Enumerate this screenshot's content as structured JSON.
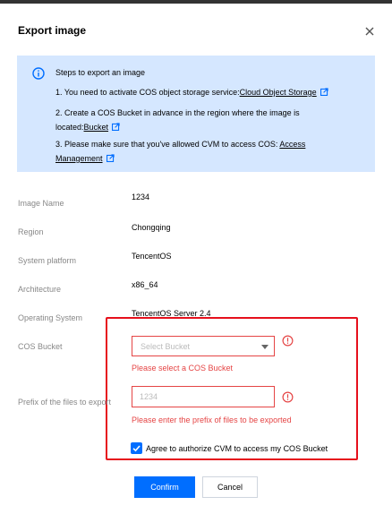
{
  "dialog": {
    "title": "Export image"
  },
  "info": {
    "heading": "Steps to export an image",
    "steps": [
      {
        "text": "1. You need to activate COS object storage service:",
        "link": "Cloud Object Storage"
      },
      {
        "text_line1": "2. Create a COS Bucket in advance in the region where the image is",
        "text_line2": "located:",
        "link": "Bucket"
      },
      {
        "text": "3. Please make sure that you've allowed CVM to access COS: ",
        "link_line1": "Access",
        "link_line2": "Management"
      }
    ]
  },
  "fields": {
    "image_name": {
      "label": "Image Name",
      "value": "1234"
    },
    "region": {
      "label": "Region",
      "value": "Chongqing"
    },
    "platform": {
      "label": "System platform",
      "value": "TencentOS"
    },
    "architecture": {
      "label": "Architecture",
      "value": "x86_64"
    },
    "os": {
      "label": "Operating System",
      "value": "TencentOS Server 2.4"
    },
    "bucket": {
      "label": "COS Bucket",
      "placeholder": "Select Bucket",
      "error": "Please select a COS Bucket"
    },
    "prefix": {
      "label": "Prefix of the files to export",
      "placeholder": "1234",
      "error": "Please enter the prefix of files to be exported"
    }
  },
  "agreement": {
    "label": "Agree to authorize CVM to access my COS Bucket",
    "checked": true
  },
  "buttons": {
    "confirm": "Confirm",
    "cancel": "Cancel"
  },
  "colors": {
    "accent": "#006eff",
    "error": "#e54545",
    "info_bg": "#d5e7ff",
    "highlight_border": "#e6101c"
  }
}
